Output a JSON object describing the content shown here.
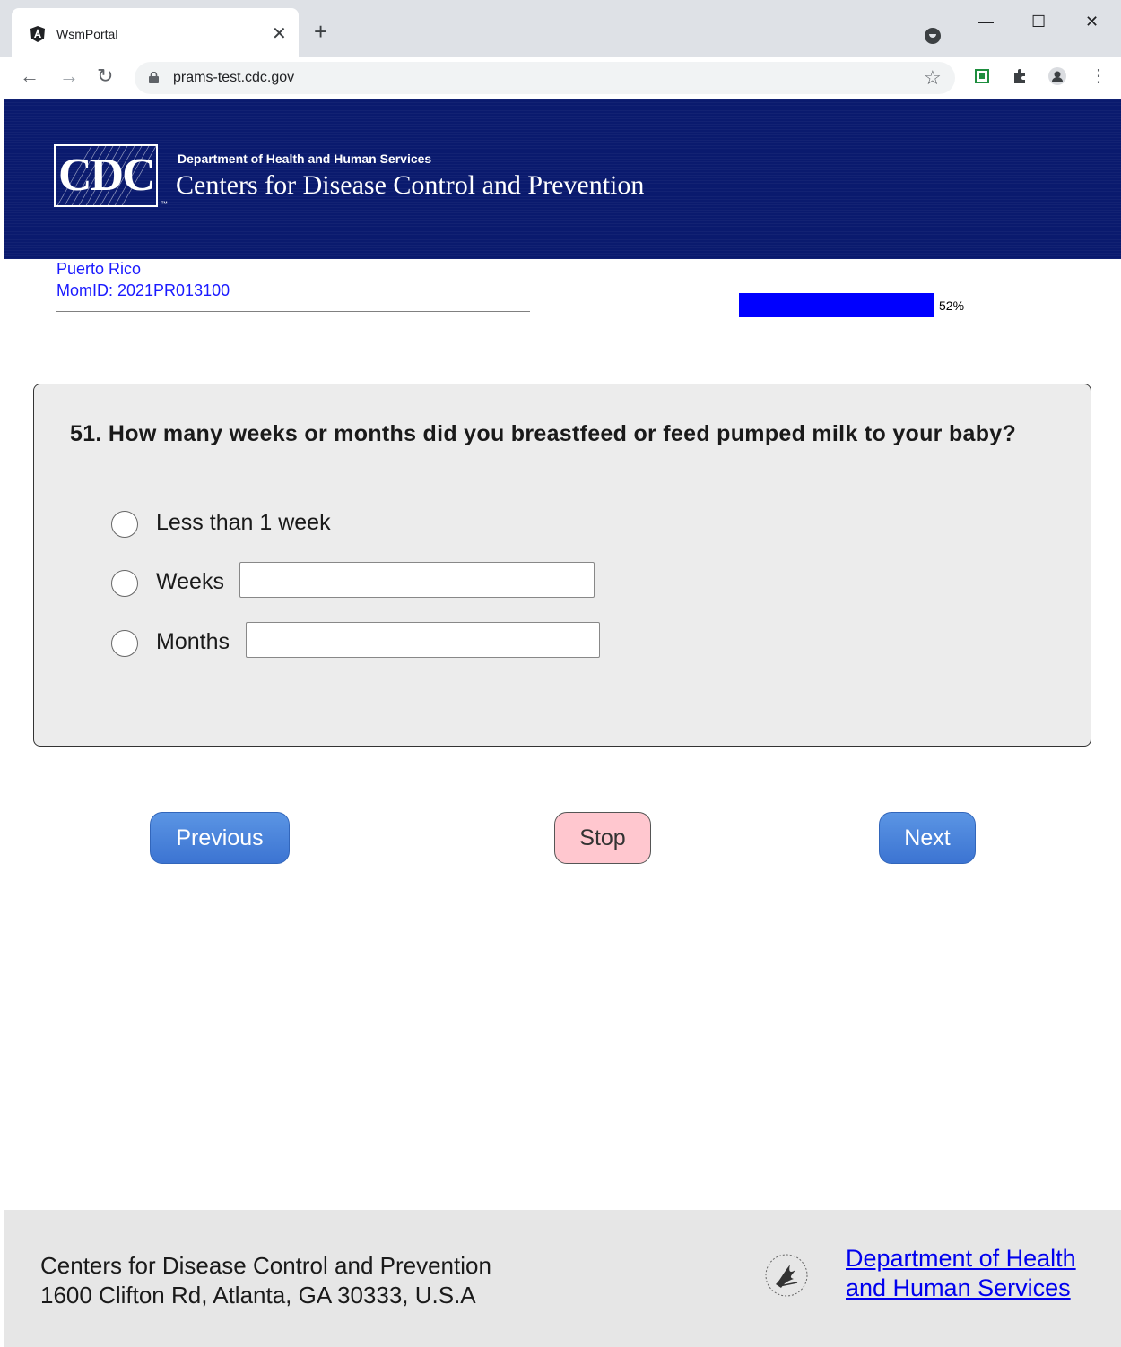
{
  "browser": {
    "tab_title": "WsmPortal",
    "tab_close": "✕",
    "new_tab": "+",
    "url": "prams-test.cdc.gov",
    "minimize": "—",
    "maximize": "☐",
    "close": "✕",
    "back": "←",
    "forward": "→",
    "reload": "↻",
    "star": "☆",
    "menu": "⋮"
  },
  "header": {
    "logo_text": "CDC",
    "dept_small": "Department of Health and Human Services",
    "dept_large": "Centers for Disease Control and Prevention"
  },
  "info": {
    "state": "Puerto Rico",
    "mom_id": "MomID: 2021PR013100",
    "progress_percent": 52,
    "progress_text": "52%"
  },
  "question": {
    "text": "51. How many weeks or months did you breastfeed or feed pumped milk to your baby?",
    "options": [
      {
        "label": "Less than 1 week"
      },
      {
        "label": "Weeks",
        "value": ""
      },
      {
        "label": "Months",
        "value": ""
      }
    ]
  },
  "buttons": {
    "previous": "Previous",
    "stop": "Stop",
    "next": "Next"
  },
  "footer": {
    "org_name": "Centers for Disease Control and Prevention",
    "address": "1600 Clifton Rd, Atlanta, GA 30333, U.S.A",
    "hhs_link_line1": "Department of Health",
    "hhs_link_line2": "and Human Services"
  },
  "colors": {
    "header_bg": "#0a1a6e",
    "progress": "#0000ff",
    "button_blue": "#4a86dc",
    "stop_pink": "#ffc7cf",
    "link": "#0000ee"
  }
}
